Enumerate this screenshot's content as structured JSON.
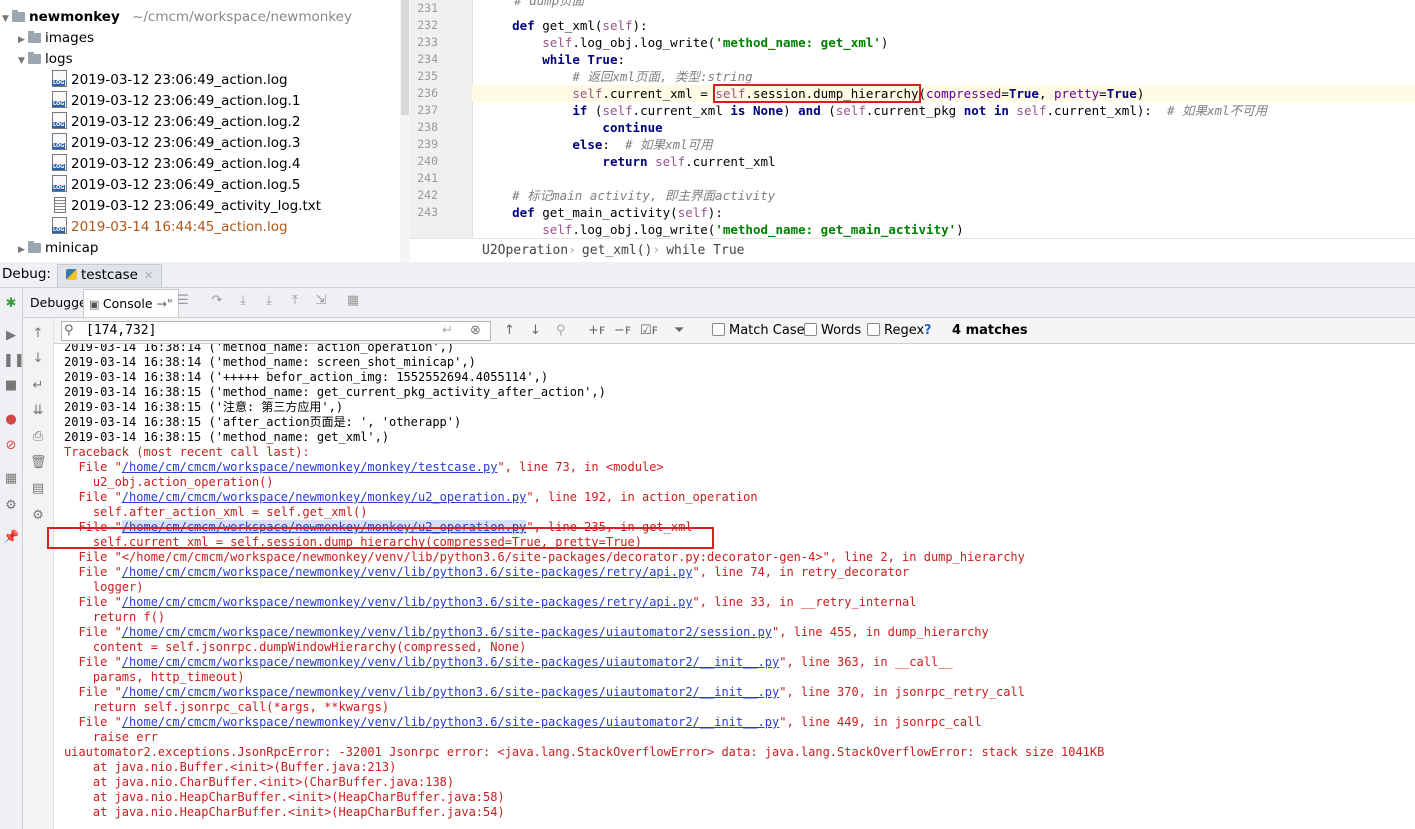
{
  "project": {
    "root_name": "newmonkey",
    "root_path": "~/cmcm/workspace/newmonkey",
    "items": [
      {
        "label": "images",
        "type": "folder",
        "expanded": false
      },
      {
        "label": "logs",
        "type": "folder",
        "expanded": true
      },
      {
        "label": "2019-03-12 23:06:49_action.log",
        "type": "log"
      },
      {
        "label": "2019-03-12 23:06:49_action.log.1",
        "type": "log"
      },
      {
        "label": "2019-03-12 23:06:49_action.log.2",
        "type": "log"
      },
      {
        "label": "2019-03-12 23:06:49_action.log.3",
        "type": "log"
      },
      {
        "label": "2019-03-12 23:06:49_action.log.4",
        "type": "log"
      },
      {
        "label": "2019-03-12 23:06:49_action.log.5",
        "type": "log"
      },
      {
        "label": "2019-03-12 23:06:49_activity_log.txt",
        "type": "txt"
      },
      {
        "label": "2019-03-14 16:44:45_action.log",
        "type": "log",
        "modified": true
      },
      {
        "label": "minicap",
        "type": "folder",
        "expanded": false
      }
    ]
  },
  "editor": {
    "line_numbers": [
      "231",
      "232",
      "233",
      "234",
      "235",
      "236",
      "237",
      "238",
      "239",
      "240",
      "241",
      "242",
      "243"
    ],
    "top_comment": "# dump页面",
    "breadcrumb": [
      "U2Operation",
      "get_xml()",
      "while True"
    ]
  },
  "debug": {
    "title": "Debug:",
    "tab": "testcase",
    "subtabs": {
      "debugger": "Debugger",
      "console": "Console"
    }
  },
  "search": {
    "query": "[174,732]",
    "match_case": "Match Case",
    "words": "Words",
    "regex": "Regex",
    "help": "?",
    "matches": "4 matches"
  },
  "console_lines": [
    {
      "text": "2019-03-14 16:38:14 ('method_name: action_operation',)",
      "style": "black"
    },
    {
      "text": "2019-03-14 16:38:14 ('method_name: screen_shot_minicap',)",
      "style": "black"
    },
    {
      "text": "2019-03-14 16:38:14 ('+++++ befor_action_img: 1552552694.4055114',)",
      "style": "black"
    },
    {
      "text": "2019-03-14 16:38:15 ('method_name: get_current_pkg_activity_after_action',)",
      "style": "black"
    },
    {
      "text": "2019-03-14 16:38:15 ('注意: 第三方应用',)",
      "style": "black"
    },
    {
      "text": "2019-03-14 16:38:15 ('after_action页面是: ', 'otherapp')",
      "style": "black"
    },
    {
      "text": "2019-03-14 16:38:15 ('method_name: get_xml',)",
      "style": "black"
    },
    {
      "text": "Traceback (most recent call last):",
      "style": "red"
    },
    {
      "pre": "  File \"",
      "link": "/home/cm/cmcm/workspace/newmonkey/monkey/testcase.py",
      "post": "\", line 73, in <module>",
      "style": "red"
    },
    {
      "text": "    u2_obj.action_operation()",
      "style": "red"
    },
    {
      "pre": "  File \"",
      "link": "/home/cm/cmcm/workspace/newmonkey/monkey/u2_operation.py",
      "post": "\", line 192, in action_operation",
      "style": "red"
    },
    {
      "text": "    self.after_action_xml = self.get_xml()",
      "style": "red"
    },
    {
      "pre": "  File \"",
      "link": "/home/cm/cmcm/workspace/newmonkey/monkey/u2_operation.py",
      "post": "\", line 235, in get_xml",
      "style": "red",
      "highlight": true
    },
    {
      "text": "    self.current_xml = self.session.dump_hierarchy(compressed=True, pretty=True)",
      "style": "red"
    },
    {
      "text": "  File \"</home/cm/cmcm/workspace/newmonkey/venv/lib/python3.6/site-packages/decorator.py:decorator-gen-4>\", line 2, in dump_hierarchy",
      "style": "red"
    },
    {
      "pre": "  File \"",
      "link": "/home/cm/cmcm/workspace/newmonkey/venv/lib/python3.6/site-packages/retry/api.py",
      "post": "\", line 74, in retry_decorator",
      "style": "red"
    },
    {
      "text": "    logger)",
      "style": "red"
    },
    {
      "pre": "  File \"",
      "link": "/home/cm/cmcm/workspace/newmonkey/venv/lib/python3.6/site-packages/retry/api.py",
      "post": "\", line 33, in __retry_internal",
      "style": "red"
    },
    {
      "text": "    return f()",
      "style": "red"
    },
    {
      "pre": "  File \"",
      "link": "/home/cm/cmcm/workspace/newmonkey/venv/lib/python3.6/site-packages/uiautomator2/session.py",
      "post": "\", line 455, in dump_hierarchy",
      "style": "red"
    },
    {
      "text": "    content = self.jsonrpc.dumpWindowHierarchy(compressed, None)",
      "style": "red"
    },
    {
      "pre": "  File \"",
      "link": "/home/cm/cmcm/workspace/newmonkey/venv/lib/python3.6/site-packages/uiautomator2/__init__.py",
      "post": "\", line 363, in __call__",
      "style": "red"
    },
    {
      "text": "    params, http_timeout)",
      "style": "red"
    },
    {
      "pre": "  File \"",
      "link": "/home/cm/cmcm/workspace/newmonkey/venv/lib/python3.6/site-packages/uiautomator2/__init__.py",
      "post": "\", line 370, in jsonrpc_retry_call",
      "style": "red"
    },
    {
      "text": "    return self.jsonrpc_call(*args, **kwargs)",
      "style": "red"
    },
    {
      "pre": "  File \"",
      "link": "/home/cm/cmcm/workspace/newmonkey/venv/lib/python3.6/site-packages/uiautomator2/__init__.py",
      "post": "\", line 449, in jsonrpc_call",
      "style": "red"
    },
    {
      "text": "    raise err",
      "style": "red"
    },
    {
      "text": "uiautomator2.exceptions.JsonRpcError: -32001 Jsonrpc error: <java.lang.StackOverflowError> data: java.lang.StackOverflowError: stack size 1041KB",
      "style": "red"
    },
    {
      "text": "    at java.nio.Buffer.<init>(Buffer.java:213)",
      "style": "red"
    },
    {
      "text": "    at java.nio.CharBuffer.<init>(CharBuffer.java:138)",
      "style": "red"
    },
    {
      "text": "    at java.nio.HeapCharBuffer.<init>(HeapCharBuffer.java:58)",
      "style": "red"
    },
    {
      "text": "    at java.nio.HeapCharBuffer.<init>(HeapCharBuffer.java:54)",
      "style": "red"
    }
  ]
}
